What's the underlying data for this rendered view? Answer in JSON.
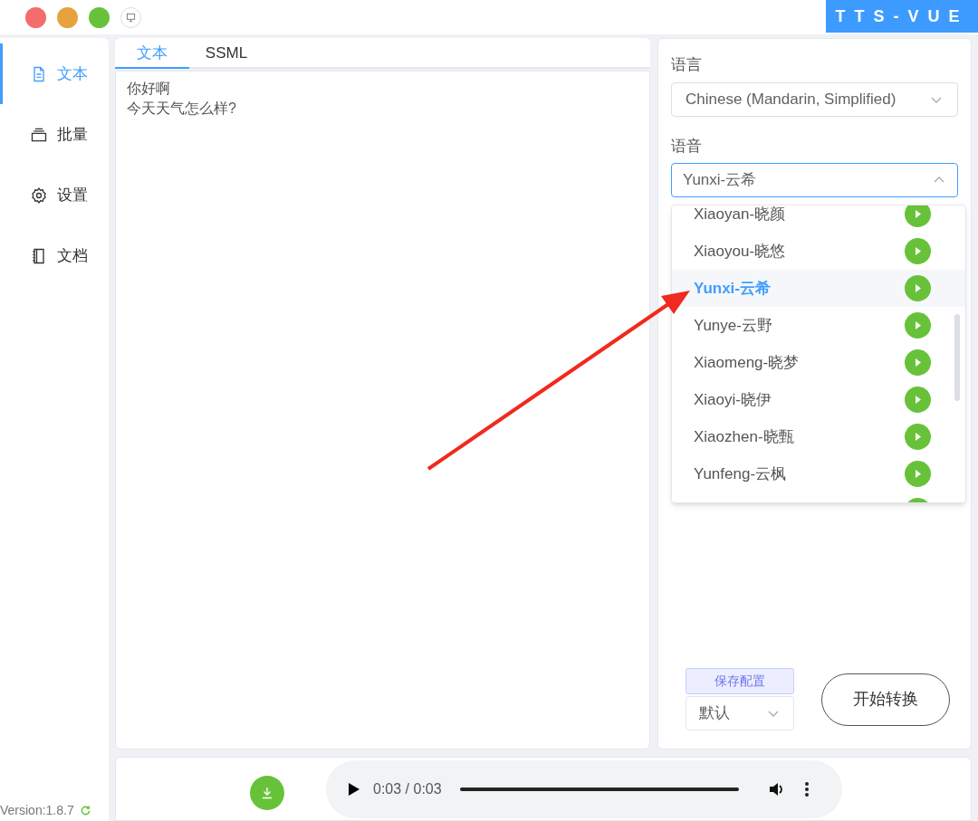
{
  "app_badge": "TTS-VUE",
  "sidebar": {
    "items": [
      {
        "label": "文本",
        "selected": true
      },
      {
        "label": "批量",
        "selected": false
      },
      {
        "label": "设置",
        "selected": false
      },
      {
        "label": "文档",
        "selected": false
      }
    ],
    "version": "Version:1.8.7"
  },
  "editor": {
    "tabs": [
      {
        "label": "文本",
        "selected": true
      },
      {
        "label": "SSML",
        "selected": false
      }
    ],
    "lines": [
      "你好啊",
      "今天天气怎么样?"
    ]
  },
  "settings": {
    "language_label": "语言",
    "language_value": "Chinese (Mandarin, Simplified)",
    "voice_label": "语音",
    "voice_value": "Yunxi-云希",
    "voice_open": true,
    "voices": [
      {
        "label": "Xiaoyan-晓颜",
        "selected": false
      },
      {
        "label": "Xiaoyou-晓悠",
        "selected": false
      },
      {
        "label": "Yunxi-云希",
        "selected": true
      },
      {
        "label": "Yunye-云野",
        "selected": false
      },
      {
        "label": "Xiaomeng-晓梦",
        "selected": false
      },
      {
        "label": "Xiaoyi-晓伊",
        "selected": false
      },
      {
        "label": "Xiaozhen-晓甄",
        "selected": false
      },
      {
        "label": "Yunfeng-云枫",
        "selected": false
      }
    ],
    "save_button": "保存配置",
    "preset_value": "默认",
    "start_button": "开始转换"
  },
  "player": {
    "time": "0:03 / 0:03",
    "level": 1
  }
}
